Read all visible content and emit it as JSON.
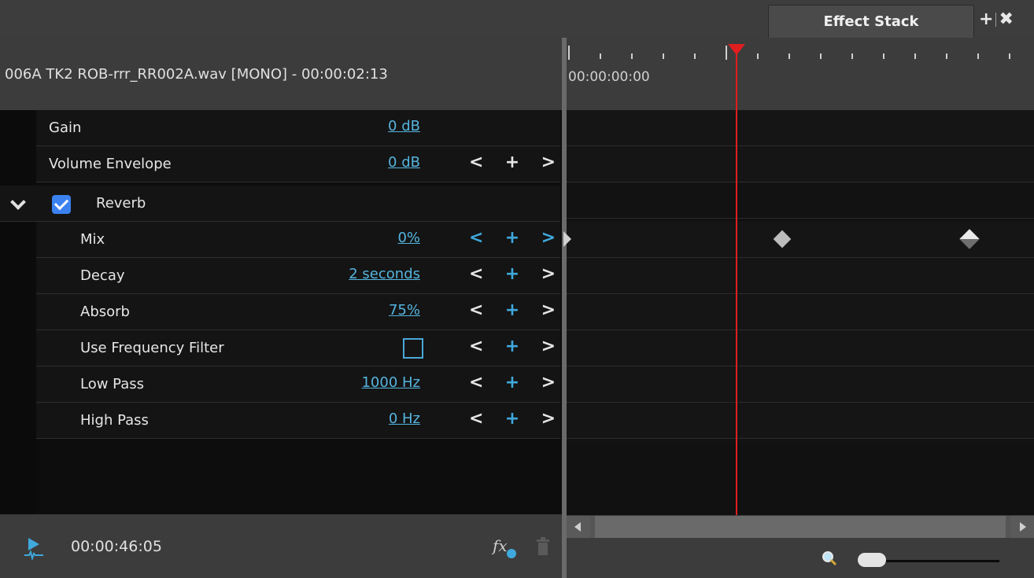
{
  "tab": {
    "label": "Effect Stack",
    "add_symbol": "+",
    "close_symbol": "✖"
  },
  "clip": {
    "title": "006A TK2 ROB-rrr_RR002A.wav  [MONO] - 00:00:02:13"
  },
  "params": {
    "gain": {
      "label": "Gain",
      "value": "0 dB"
    },
    "volume_envelope": {
      "label": "Volume Envelope",
      "value": "0 dB"
    },
    "reverb": {
      "label": "Reverb",
      "enabled": true,
      "items": [
        {
          "label": "Mix",
          "value": "0%"
        },
        {
          "label": "Decay",
          "value": "2 seconds"
        },
        {
          "label": "Absorb",
          "value": "75%"
        },
        {
          "label": "Use Frequency Filter",
          "value": ""
        },
        {
          "label": "Low Pass",
          "value": "1000 Hz"
        },
        {
          "label": "High Pass",
          "value": "0 Hz"
        }
      ]
    }
  },
  "nav": {
    "prev": "<",
    "add": "+",
    "next": ">"
  },
  "footer": {
    "timecode": "00:00:46:05"
  },
  "timeline": {
    "start_time": "00:00:00:00"
  },
  "colors": {
    "accent": "#55b4de",
    "playhead": "#e01e1e",
    "background": "#3c3c3c"
  },
  "icons": [
    "play-icon",
    "fx-add-icon",
    "trash-icon",
    "magnifier-icon",
    "chevron-down-icon",
    "checkbox-icon"
  ]
}
